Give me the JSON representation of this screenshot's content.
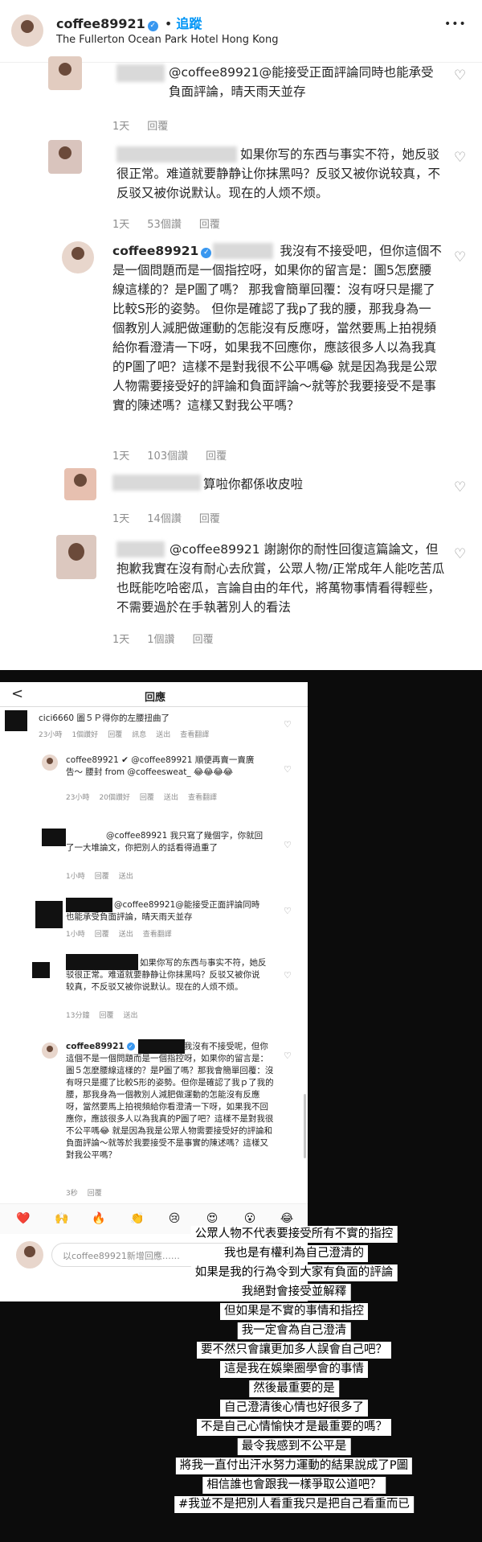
{
  "header": {
    "username": "coffee89921",
    "follow": "追蹤",
    "location": "The Fullerton Ocean Park Hotel Hong Kong",
    "more": "•••"
  },
  "comments": [
    {
      "text": "@coffee89921@能接受正面評論同時也能承受負面評論，晴天雨天並存",
      "time": "1天",
      "reply": "回覆"
    },
    {
      "text": "如果你写的东西与事实不符，她反驳很正常。难道就要静静让你抹黑吗？反驳又被你说较真，不反驳又被你说默认。现在的人烦不烦。",
      "time": "1天",
      "likes": "53個讚",
      "reply": "回覆"
    },
    {
      "user": "coffee89921",
      "text": "我沒有不接受吧，但你這個不是一個問題而是一個指控呀，如果你的留言是：圖5怎麼腰線這樣的？是P圖了嗎？ 那我會簡單回覆：沒有呀只是擺了比較S形的姿勢。 但你是確認了我p了我的腰，那我身為一個教別人減肥做運動的怎能沒有反應呀，當然要馬上拍視頻給你看澄清一下呀，如果我不回應你，應該很多人以為我真的P圖了吧？這樣不是對我很不公平嗎😂 就是因為我是公眾人物需要接受好的評論和負面評論～就等於我要接受不是事實的陳述嗎？這樣又對我公平嗎？",
      "time": "1天",
      "likes": "103個讚",
      "reply": "回覆"
    },
    {
      "text": "算啦你都係收皮啦",
      "time": "1天",
      "likes": "14個讚",
      "reply": "回覆"
    },
    {
      "text": "@coffee89921 謝謝你的耐性回復這篇論文，但抱歉我實在沒有耐心去欣賞，公眾人物/正常成年人能吃苦瓜也既能吃哈密瓜，言論自由的年代，將萬物事情看得輕些，不需要過於在手執著別人的看法",
      "time": "1天",
      "likes": "1個讚",
      "reply": "回覆"
    }
  ],
  "shot2": {
    "back": "<",
    "title": "回應",
    "c1": {
      "text": "cici6660 圖５Ｐ得你的左腰扭曲了",
      "meta": [
        "23小時",
        "1個讚好",
        "回覆",
        "訊息",
        "送出",
        "查看翻譯"
      ]
    },
    "c2": {
      "text": "coffee89921 ✔ @coffee89921 順便再賣一賣廣告～ 腰封 from @coffeesweat_ 😂😂😂😂",
      "meta": [
        "23小時",
        "20個讚好",
        "回覆",
        "送出",
        "查看翻譯"
      ]
    },
    "c3": {
      "text": "@coffee89921 我只寫了幾個字，你就回了一大堆論文，你把別人的話看得過重了",
      "meta": [
        "1小時",
        "回覆",
        "送出"
      ]
    },
    "c4": {
      "text": "@coffee89921@能接受正面評論同時也能承受負面評論，晴天雨天並存",
      "meta": [
        "1小時",
        "回覆",
        "送出",
        "查看翻譯"
      ]
    },
    "c5": {
      "text": "如果你写的东西与事实不符，她反驳很正常。难道就要静静让你抹黑吗？反驳又被你说较真，不反驳又被你说默认。现在的人烦不烦。",
      "meta": [
        "13分鐘",
        "回覆",
        "送出"
      ]
    },
    "c6": {
      "user": "coffee89921",
      "text": "我沒有不接受呢，但你這個不是一個問題而是一個指控呀，如果你的留言是：圖５怎麼腰線這樣的？是P圖了嗎？那我會簡單回覆：沒有呀只是擺了比較S形的姿勢。但你是確認了我ｐ了我的腰，那我身為一個教別人減肥做運動的怎能沒有反應呀，當然要馬上拍視頻給你看澄清一下呀，如果我不回應你，應該很多人以為我真的P圖了吧？這樣不是對我很不公平嗎😂 就是因為我是公眾人物需要接受好的評論和負面評論～就等於我要接受不是事實的陳述嗎？這樣又對我公平嗎？",
      "meta": [
        "3秒",
        "回覆"
      ]
    },
    "emojis": [
      "❤️",
      "🙌",
      "🔥",
      "👏",
      "😢",
      "😍",
      "😮",
      "😂"
    ],
    "input_placeholder": "以coffee89921新增回應……"
  },
  "captions": [
    "公眾人物不代表要接受所有不實的指控",
    "我也是有權利為自己澄清的",
    "如果是我的行為令到大家有負面的評論",
    "我絕對會接受並解釋",
    "但如果是不實的事情和指控",
    "我一定會為自己澄清",
    "要不然只會讓更加多人誤會自己吧？",
    "這是我在娛樂圈學會的事情",
    "然後最重要的是",
    "自己澄清後心情也好很多了",
    "不是自己心情愉快才是最重要的嗎？",
    "最令我感到不公平是",
    "將我一直付出汗水努力運動的結果說成了P圖",
    "相信誰也會跟我一樣爭取公道吧？",
    "#我並不是把別人看重我只是把自己看重而已"
  ]
}
